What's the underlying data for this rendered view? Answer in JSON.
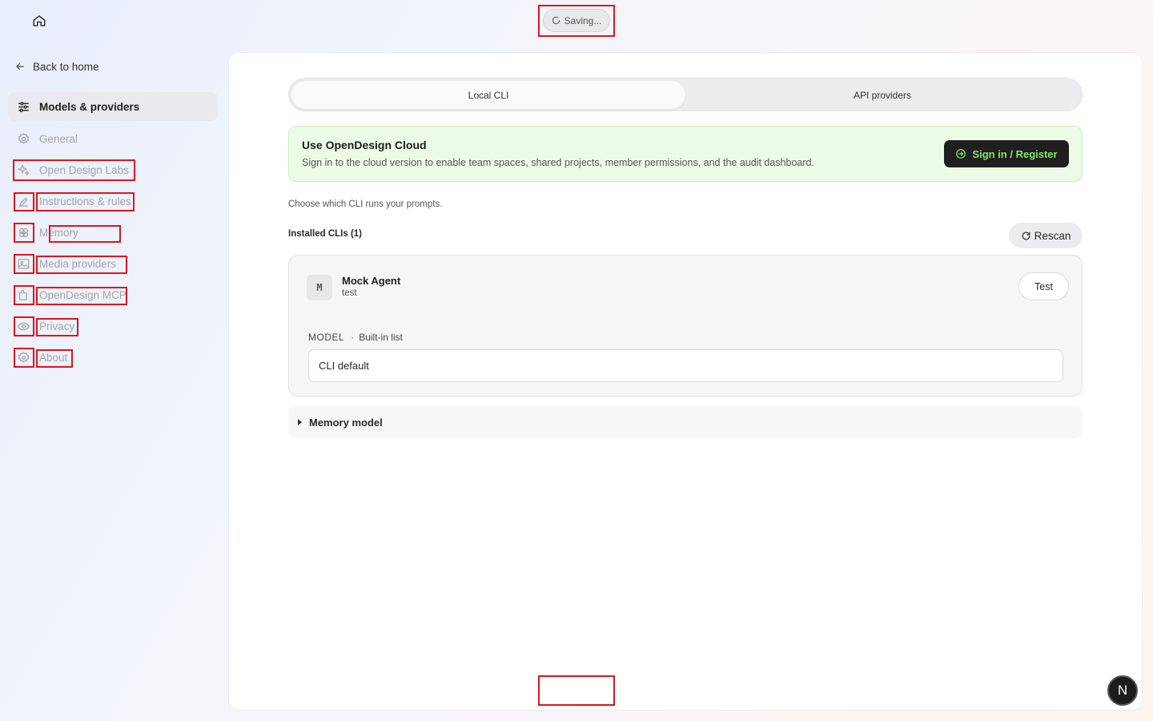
{
  "status": {
    "saving_label": "Saving..."
  },
  "sidebar": {
    "back_label": "Back to home",
    "items": [
      {
        "label": "Models & providers",
        "icon": "sliders-icon",
        "active": true
      },
      {
        "label": "General",
        "icon": "gear-icon"
      },
      {
        "label": "Open Design Labs",
        "icon": "sparkles-icon"
      },
      {
        "label": "Instructions & rules",
        "icon": "pencil-icon"
      },
      {
        "label": "Memory",
        "icon": "brain-icon"
      },
      {
        "label": "Media providers",
        "icon": "image-icon"
      },
      {
        "label": "OpenDesign MCP",
        "icon": "plugin-icon"
      },
      {
        "label": "Privacy",
        "icon": "eye-icon"
      },
      {
        "label": "About",
        "icon": "info-gear-icon"
      }
    ]
  },
  "tabs": {
    "local": "Local CLI",
    "api": "API providers",
    "selected": "Local CLI"
  },
  "cloud": {
    "title": "Use OpenDesign Cloud",
    "description": "Sign in to the cloud version to enable team spaces, shared projects, member permissions, and the audit dashboard.",
    "button_label": "Sign in / Register"
  },
  "cli": {
    "intro": "Choose which CLI runs your prompts.",
    "installed_label": "Installed CLIs (1)",
    "rescan_label": "Rescan",
    "agent": {
      "avatar": "M",
      "name": "Mock Agent",
      "subtitle": "test",
      "test_label": "Test",
      "model_label": "MODEL",
      "model_source": "Built-in list",
      "model_value": "CLI default"
    }
  },
  "memory_model_label": "Memory model",
  "dev_badge": "N",
  "colors": {
    "accent_green": "#86e866",
    "banner_bg": "#ecfbe6",
    "annotation_red": "#e0141e"
  }
}
